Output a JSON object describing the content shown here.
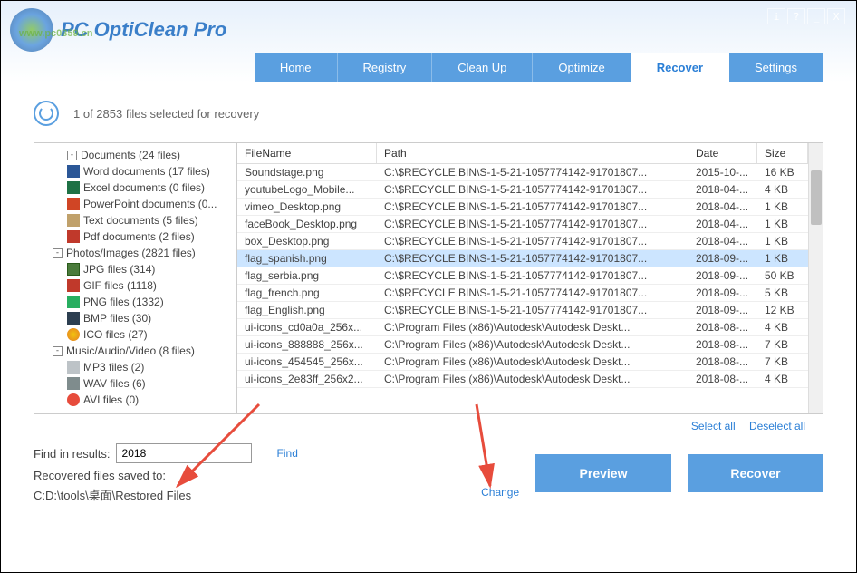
{
  "app": {
    "title": "PC OptiClean Pro",
    "watermark": "www.pc0359.cn"
  },
  "titlebar": {
    "info": "i",
    "help": "?",
    "min": "_",
    "close": "X"
  },
  "tabs": [
    {
      "label": "Home",
      "active": false
    },
    {
      "label": "Registry",
      "active": false
    },
    {
      "label": "Clean Up",
      "active": false
    },
    {
      "label": "Optimize",
      "active": false
    },
    {
      "label": "Recover",
      "active": true
    },
    {
      "label": "Settings",
      "active": false
    }
  ],
  "status": "1 of 2853 files selected for recovery",
  "tree": [
    {
      "level": "cut",
      "label": "Documents (24 files)",
      "toggle": "-"
    },
    {
      "level": 2,
      "ico": "ico-word",
      "label": "Word documents (17 files)"
    },
    {
      "level": 2,
      "ico": "ico-excel",
      "label": "Excel documents (0 files)"
    },
    {
      "level": 2,
      "ico": "ico-ppt",
      "label": "PowerPoint documents (0..."
    },
    {
      "level": 2,
      "ico": "ico-txt",
      "label": "Text documents (5 files)"
    },
    {
      "level": 2,
      "ico": "ico-pdf",
      "label": "Pdf documents (2 files)"
    },
    {
      "level": 1,
      "toggle": "-",
      "label": "Photos/Images (2821 files)"
    },
    {
      "level": 2,
      "ico": "ico-jpg",
      "label": "JPG files (314)"
    },
    {
      "level": 2,
      "ico": "ico-gif",
      "label": "GIF files (1118)"
    },
    {
      "level": 2,
      "ico": "ico-png",
      "label": "PNG files (1332)"
    },
    {
      "level": 2,
      "ico": "ico-bmp",
      "label": "BMP files (30)"
    },
    {
      "level": 2,
      "ico": "ico-ico",
      "label": "ICO files (27)"
    },
    {
      "level": 1,
      "toggle": "-",
      "label": "Music/Audio/Video (8 files)"
    },
    {
      "level": 2,
      "ico": "ico-mp3",
      "label": "MP3 files (2)"
    },
    {
      "level": 2,
      "ico": "ico-wav",
      "label": "WAV files (6)"
    },
    {
      "level": 2,
      "ico": "ico-avi",
      "label": "AVI files (0)"
    }
  ],
  "columns": {
    "name": "FileName",
    "path": "Path",
    "date": "Date",
    "size": "Size"
  },
  "rows": [
    {
      "name": "Soundstage.png",
      "path": "C:\\$RECYCLE.BIN\\S-1-5-21-1057774142-91701807...",
      "date": "2015-10-...",
      "size": "16 KB",
      "selected": false
    },
    {
      "name": "youtubeLogo_Mobile...",
      "path": "C:\\$RECYCLE.BIN\\S-1-5-21-1057774142-91701807...",
      "date": "2018-04-...",
      "size": "4 KB",
      "selected": false
    },
    {
      "name": "vimeo_Desktop.png",
      "path": "C:\\$RECYCLE.BIN\\S-1-5-21-1057774142-91701807...",
      "date": "2018-04-...",
      "size": "1 KB",
      "selected": false
    },
    {
      "name": "faceBook_Desktop.png",
      "path": "C:\\$RECYCLE.BIN\\S-1-5-21-1057774142-91701807...",
      "date": "2018-04-...",
      "size": "1 KB",
      "selected": false
    },
    {
      "name": "box_Desktop.png",
      "path": "C:\\$RECYCLE.BIN\\S-1-5-21-1057774142-91701807...",
      "date": "2018-04-...",
      "size": "1 KB",
      "selected": false
    },
    {
      "name": "flag_spanish.png",
      "path": "C:\\$RECYCLE.BIN\\S-1-5-21-1057774142-91701807...",
      "date": "2018-09-...",
      "size": "1 KB",
      "selected": true
    },
    {
      "name": "flag_serbia.png",
      "path": "C:\\$RECYCLE.BIN\\S-1-5-21-1057774142-91701807...",
      "date": "2018-09-...",
      "size": "50 KB",
      "selected": false
    },
    {
      "name": "flag_french.png",
      "path": "C:\\$RECYCLE.BIN\\S-1-5-21-1057774142-91701807...",
      "date": "2018-09-...",
      "size": "5 KB",
      "selected": false
    },
    {
      "name": "flag_English.png",
      "path": "C:\\$RECYCLE.BIN\\S-1-5-21-1057774142-91701807...",
      "date": "2018-09-...",
      "size": "12 KB",
      "selected": false
    },
    {
      "name": "ui-icons_cd0a0a_256x...",
      "path": "C:\\Program Files (x86)\\Autodesk\\Autodesk Deskt...",
      "date": "2018-08-...",
      "size": "4 KB",
      "selected": false
    },
    {
      "name": "ui-icons_888888_256x...",
      "path": "C:\\Program Files (x86)\\Autodesk\\Autodesk Deskt...",
      "date": "2018-08-...",
      "size": "7 KB",
      "selected": false
    },
    {
      "name": "ui-icons_454545_256x...",
      "path": "C:\\Program Files (x86)\\Autodesk\\Autodesk Deskt...",
      "date": "2018-08-...",
      "size": "7 KB",
      "selected": false
    },
    {
      "name": "ui-icons_2e83ff_256x2...",
      "path": "C:\\Program Files (x86)\\Autodesk\\Autodesk Deskt...",
      "date": "2018-08-...",
      "size": "4 KB",
      "selected": false
    }
  ],
  "links": {
    "select_all": "Select all",
    "deselect_all": "Deselect all",
    "find": "Find",
    "change": "Change"
  },
  "find": {
    "label": "Find in results:",
    "value": "2018"
  },
  "saved": {
    "label": "Recovered files saved to:",
    "path": "C:D:\\tools\\桌面\\Restored Files"
  },
  "buttons": {
    "preview": "Preview",
    "recover": "Recover"
  }
}
